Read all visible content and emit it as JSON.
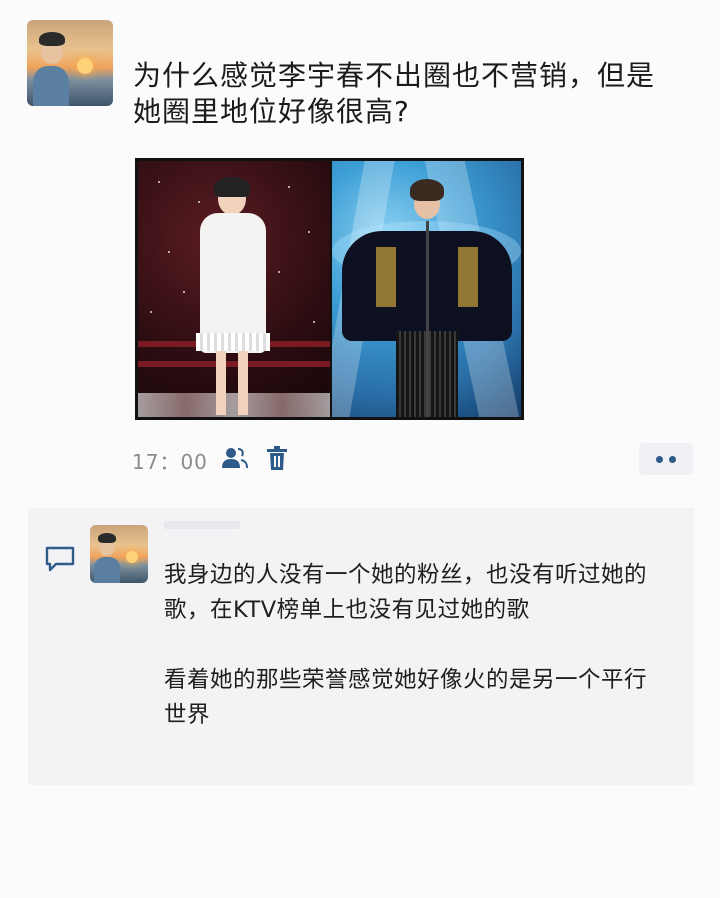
{
  "post": {
    "title_line1": "为什么感觉李宇春不出圈也不营销，但是",
    "title_line2": "她圈里地位好像很高?",
    "time": "17：00"
  },
  "icons": {
    "avatar": "avatar",
    "visibility": "person-group-icon",
    "delete": "trash-icon",
    "more": "more-dots-icon",
    "comment": "comment-bubble-icon"
  },
  "comment": {
    "paragraph1": "我身边的人没有一个她的粉丝，也没有听过她的歌，在KTV榜单上也没有见过她的歌",
    "paragraph2": "看着她的那些荣誉感觉她好像火的是另一个平行世界"
  },
  "colors": {
    "accent": "#2f5b8a",
    "meta_text": "#8b8b8b",
    "comment_bg": "#f3f3f5"
  }
}
